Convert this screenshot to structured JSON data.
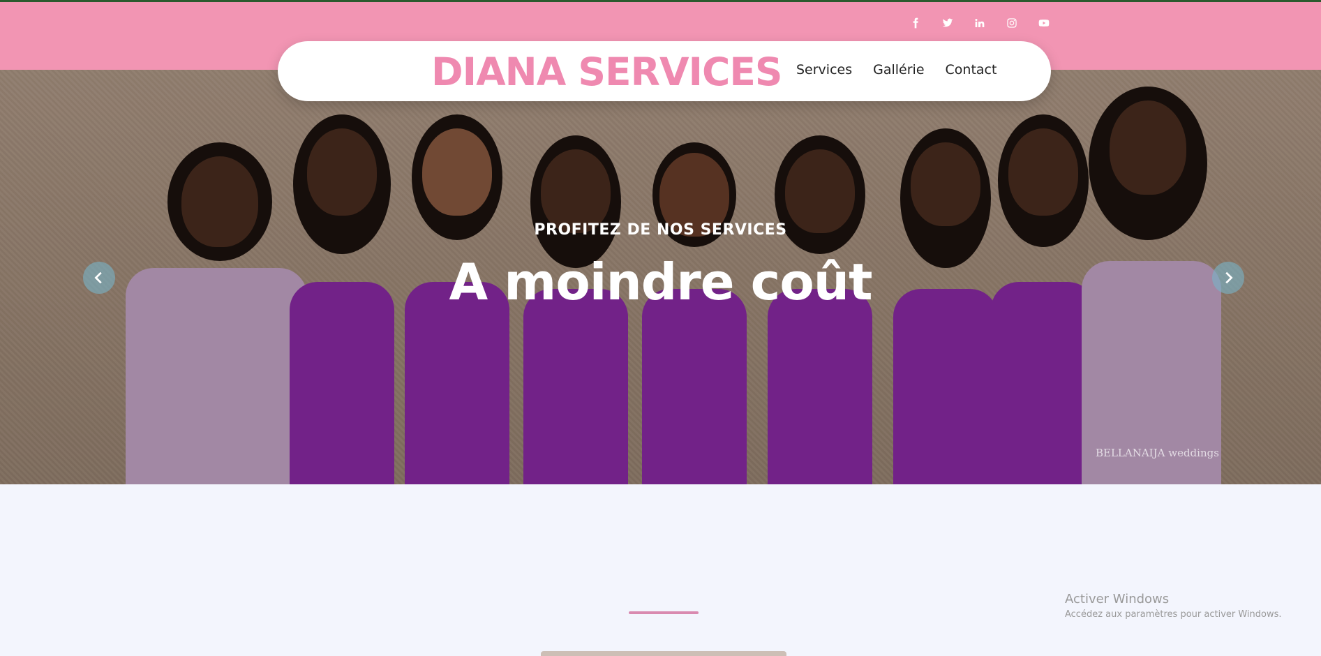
{
  "header": {
    "brand": "DIANA SERVICES",
    "nav": [
      {
        "label": "Services"
      },
      {
        "label": "Gallérie"
      },
      {
        "label": "Contact"
      }
    ],
    "socials": [
      "facebook-icon",
      "twitter-icon",
      "linkedin-icon",
      "instagram-icon",
      "youtube-icon"
    ]
  },
  "hero": {
    "subtitle": "PROFITEZ DE NOS SERVICES",
    "title": "A moindre coût",
    "watermark": "BELLANAIJA weddings"
  },
  "windows_activation": {
    "title": "Activer Windows",
    "subtitle": "Accédez aux paramètres pour activer Windows."
  },
  "colors": {
    "brand_pink": "#f295b3",
    "brand_text": "#ef89b0",
    "dress_purple": "#8b2aa6",
    "dress_lilac": "#c6a6c9"
  }
}
